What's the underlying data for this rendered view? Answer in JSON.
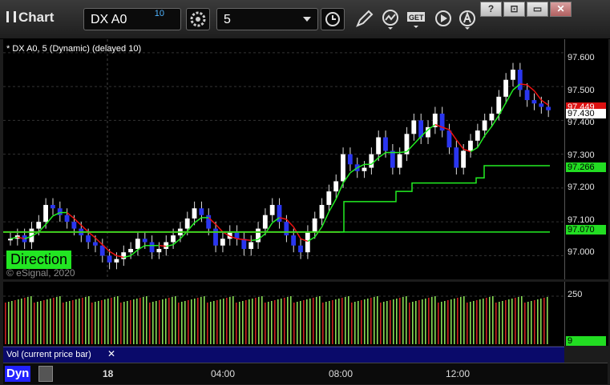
{
  "window": {
    "title": "Chart"
  },
  "toolbar": {
    "symbol": "DX A0",
    "delay_badge": "10",
    "interval": "5",
    "tools": [
      "link-gear-icon",
      "time-clock-icon",
      "draw-pencil-icon",
      "study-curve-icon",
      "get-data-icon",
      "play-icon",
      "alert-icon"
    ],
    "window_buttons": [
      "?",
      "⊡",
      "▭",
      "✕"
    ]
  },
  "chart": {
    "header": "* DX A0, 5 (Dynamic) (delayed 10)",
    "direction_label": "Direction",
    "watermark": "© eSignal, 2020",
    "colors": {
      "background": "#000000",
      "up": "#ffffff",
      "down": "#2233ee",
      "fast_line_up": "#22ee22",
      "fast_line_down": "#ee1111",
      "stop_line": "#22ee22",
      "last_tag": "#ffffff"
    }
  },
  "price_scale": {
    "ticks": [
      "97.600",
      "97.500",
      "97.400",
      "97.300",
      "97.200",
      "97.100",
      "97.000"
    ],
    "tags": [
      {
        "text": "97.449",
        "bg": "#dd1111",
        "fg": "#ffffff"
      },
      {
        "text": "97.430",
        "bg": "#ffffff",
        "fg": "#000000"
      },
      {
        "text": "97.266",
        "bg": "#22dd22",
        "fg": "#000000"
      },
      {
        "text": "97.070",
        "bg": "#22dd22",
        "fg": "#000000"
      }
    ]
  },
  "volume": {
    "label": "Vol (current price bar)",
    "close": "✕",
    "ticks": [
      "250"
    ],
    "tag": "9"
  },
  "time_axis": {
    "mode_label": "Dyn",
    "labels": [
      "18",
      "04:00",
      "08:00",
      "12:00"
    ]
  },
  "chart_data": {
    "type": "candlestick",
    "y_range": [
      96.93,
      97.64
    ],
    "candles_close": [
      97.05,
      97.06,
      97.04,
      97.08,
      97.1,
      97.15,
      97.14,
      97.12,
      97.1,
      97.08,
      97.06,
      97.04,
      97.03,
      97.0,
      96.98,
      96.99,
      97.01,
      97.02,
      97.05,
      97.04,
      97.01,
      97.02,
      97.04,
      97.06,
      97.08,
      97.11,
      97.14,
      97.12,
      97.08,
      97.03,
      97.05,
      97.07,
      97.05,
      97.02,
      97.04,
      97.08,
      97.12,
      97.15,
      97.1,
      97.06,
      97.03,
      97.01,
      97.07,
      97.11,
      97.15,
      97.19,
      97.22,
      97.3,
      97.27,
      97.25,
      97.26,
      97.3,
      97.35,
      97.31,
      97.26,
      97.3,
      97.36,
      97.4,
      97.35,
      97.38,
      97.42,
      97.37,
      97.32,
      97.26,
      97.31,
      97.34,
      97.37,
      97.4,
      97.42,
      97.47,
      97.52,
      97.55,
      97.49,
      97.46,
      97.45,
      97.44,
      97.43
    ],
    "volume_max": 250
  }
}
